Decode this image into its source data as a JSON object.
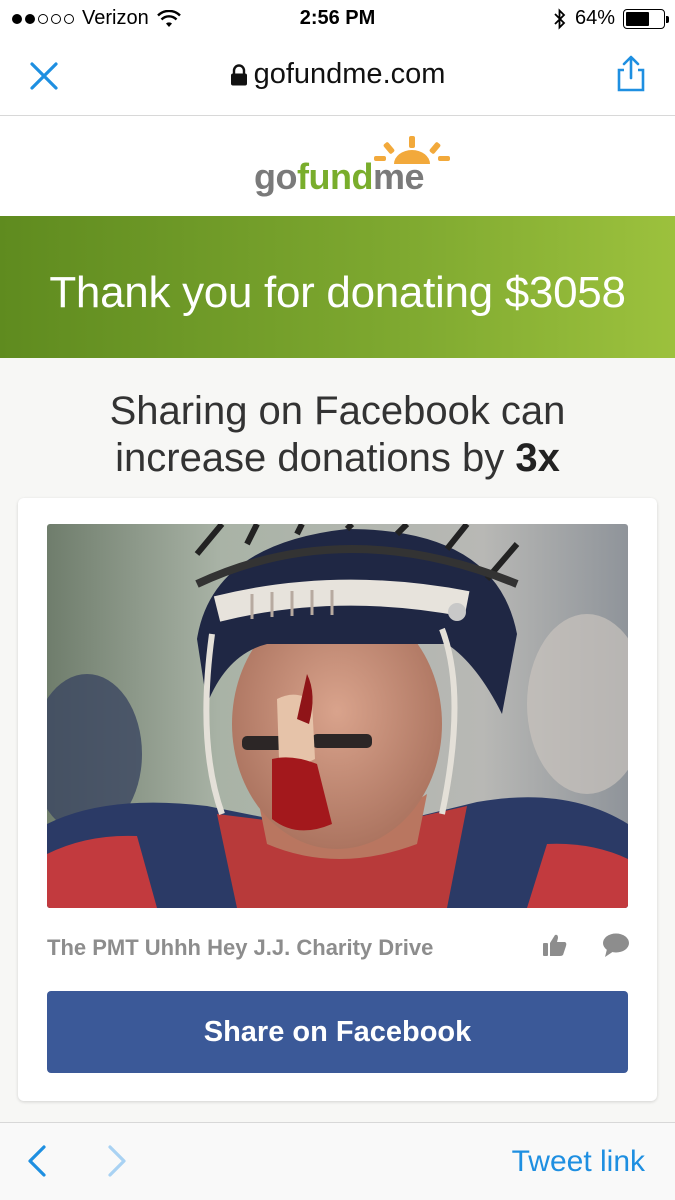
{
  "status": {
    "carrier": "Verizon",
    "time": "2:56 PM",
    "battery": "64%",
    "battery_level": 0.64,
    "signal_bars_filled": 2,
    "signal_bars_total": 5
  },
  "browser": {
    "domain": "gofundme.com",
    "icons": [
      "close-icon",
      "lock-icon",
      "share-icon"
    ]
  },
  "logo": {
    "go": "go",
    "fund": "fund",
    "me": "me"
  },
  "banner": {
    "text": "Thank you for donating $3058"
  },
  "share": {
    "heading_line1": "Sharing on Facebook can",
    "heading_line2_prefix": "increase donations by ",
    "heading_multiplier": "3x"
  },
  "card": {
    "caption": "The PMT Uhhh Hey J.J. Charity Drive",
    "button_label": "Share on Facebook"
  },
  "toolbar": {
    "tweet_link": "Tweet link"
  },
  "colors": {
    "brand_green": "#79ad2c",
    "facebook_blue": "#3b5998",
    "ios_blue": "#1e8fe1"
  }
}
